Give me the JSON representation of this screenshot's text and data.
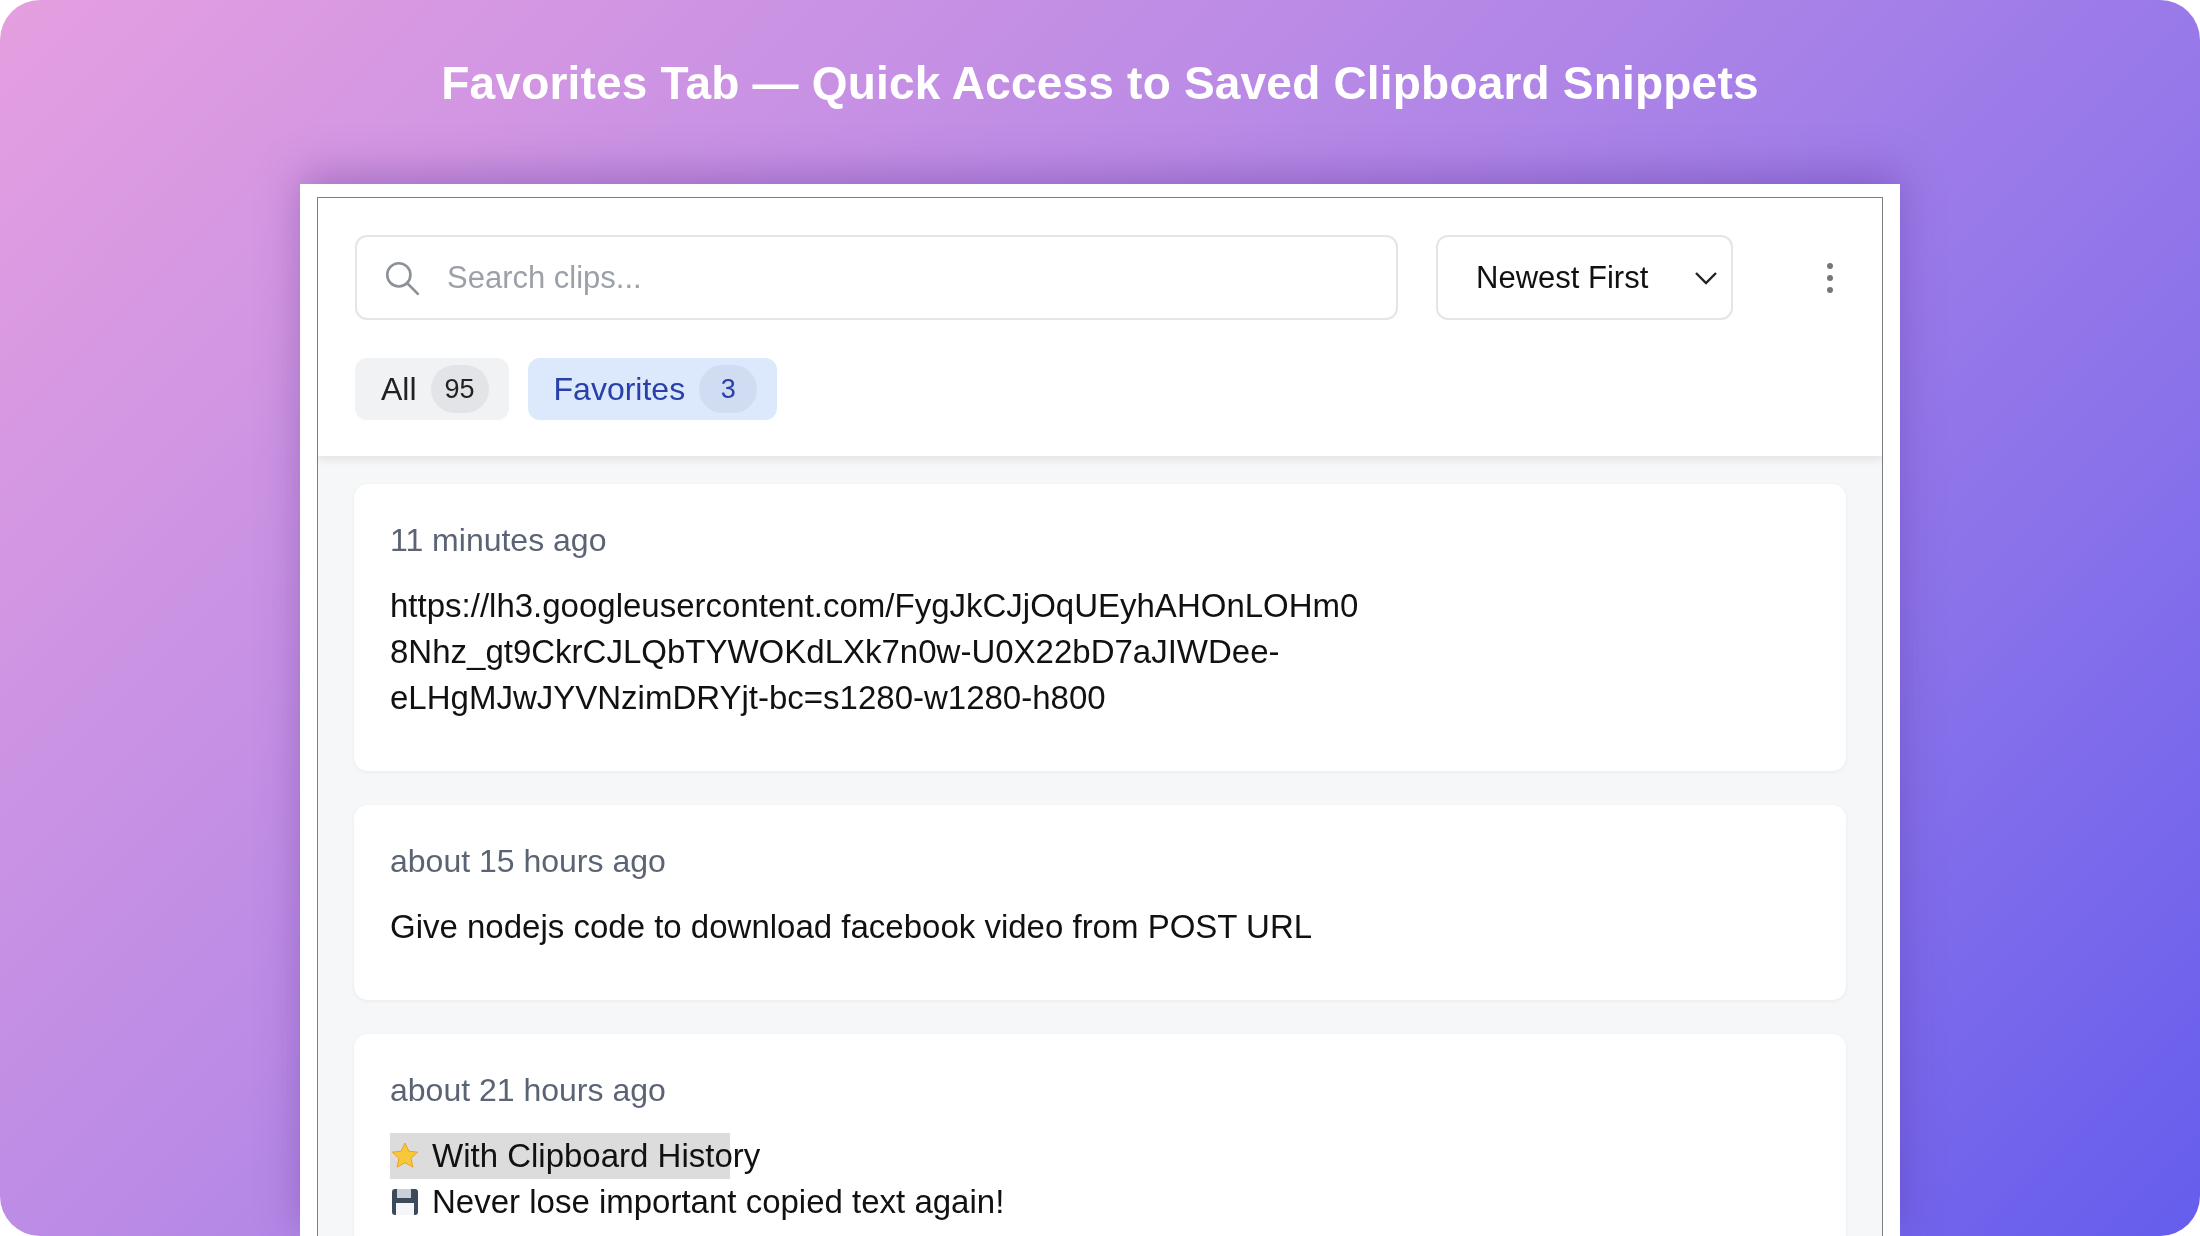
{
  "title": "Favorites Tab — Quick Access to Saved Clipboard Snippets",
  "search": {
    "placeholder": "Search clips..."
  },
  "sort": {
    "value": "Newest First"
  },
  "tabs": [
    {
      "label": "All",
      "count": "95",
      "selected": false
    },
    {
      "label": "Favorites",
      "count": "3",
      "selected": true
    }
  ],
  "clips": [
    {
      "time": "11 minutes ago",
      "lines": [
        {
          "kind": "plain",
          "text": "https://lh3.googleusercontent.com/FygJkCJjOqUEyhAHOnLOHm0",
          "highlighted": false
        },
        {
          "kind": "plain",
          "text": "8Nhz_gt9CkrCJLQbTYWOKdLXk7n0w-U0X22bD7aJIWDee-",
          "highlighted": false
        },
        {
          "kind": "plain",
          "text": "eLHgMJwJYVNzimDRYjt-bc=s1280-w1280-h800",
          "highlighted": false
        }
      ]
    },
    {
      "time": "about 15 hours ago",
      "lines": [
        {
          "kind": "plain",
          "text": "Give nodejs code to download facebook video from POST URL",
          "highlighted": false
        }
      ]
    },
    {
      "time": "about 21 hours ago",
      "lines": [
        {
          "kind": "star",
          "text": "With Clipboard History",
          "highlighted": true
        },
        {
          "kind": "disk",
          "text": "Never lose important copied text again!",
          "highlighted": false
        }
      ]
    }
  ]
}
